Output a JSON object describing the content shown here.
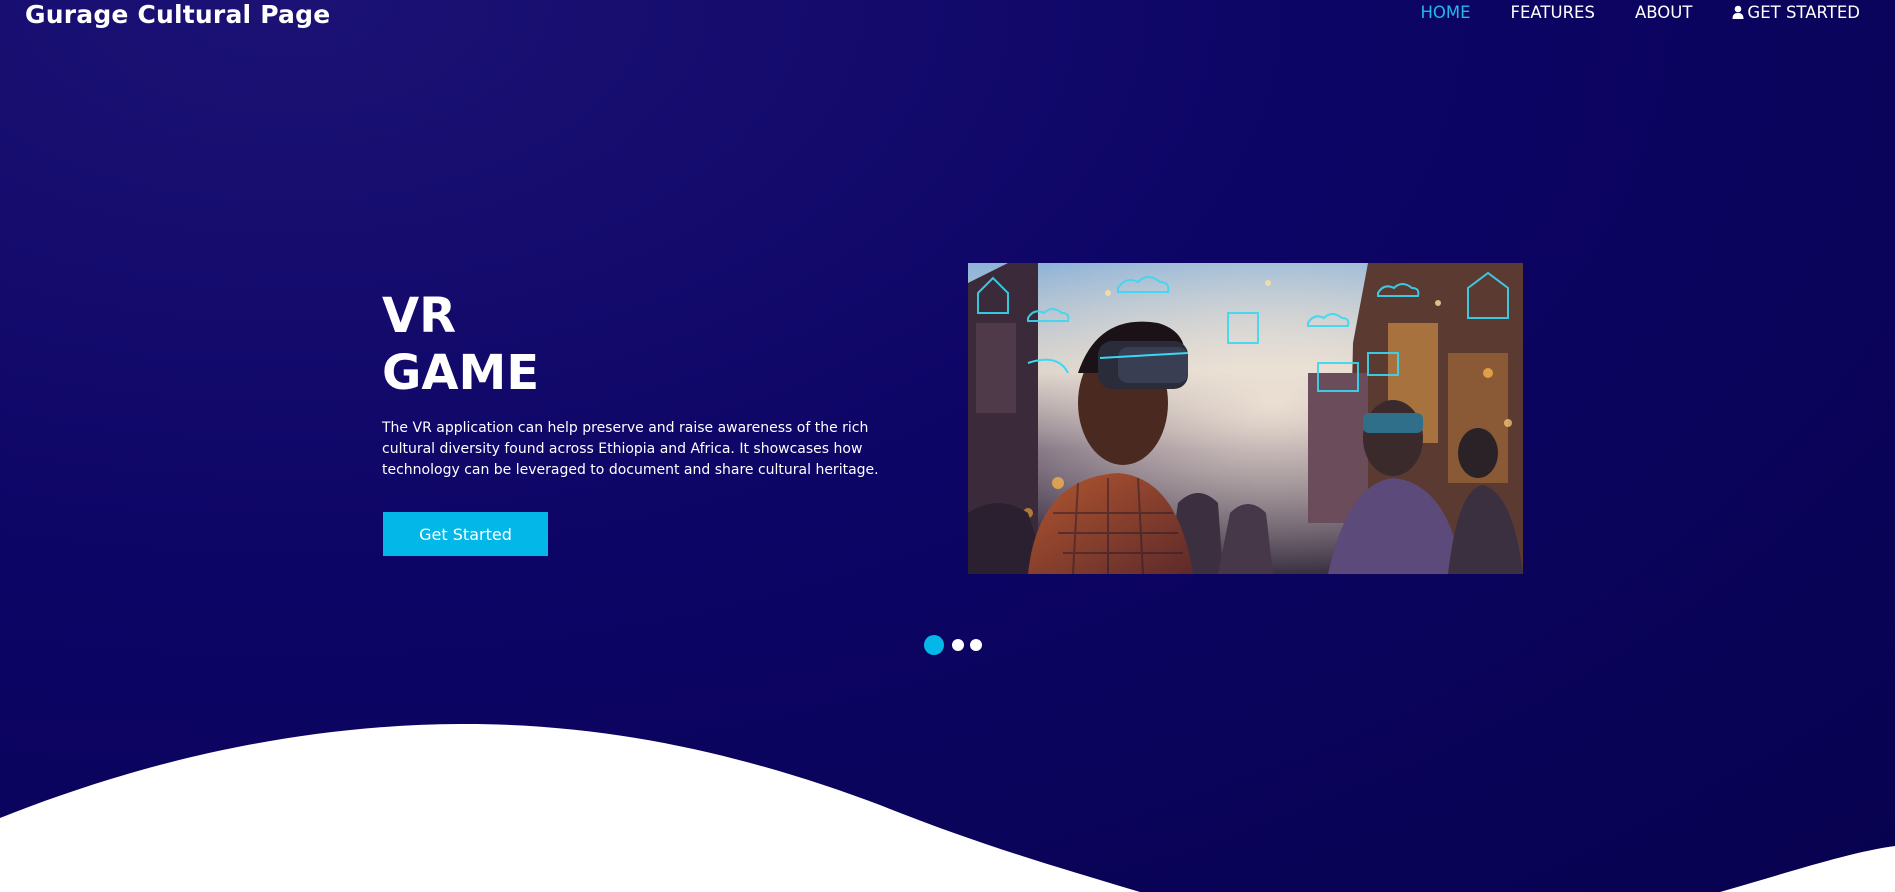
{
  "header": {
    "brand": "Gurage Cultural Page"
  },
  "nav": {
    "items": [
      {
        "label": "HOME",
        "active": true
      },
      {
        "label": "FEATURES",
        "active": false
      },
      {
        "label": "ABOUT",
        "active": false
      },
      {
        "label": "GET STARTED",
        "active": false,
        "icon": "user-icon"
      }
    ]
  },
  "hero": {
    "title_line1": "VR",
    "title_line2": "GAME",
    "description": "The VR application can help preserve and raise awareness of the rich cultural diversity found across Ethiopia and Africa. It showcases how technology can be leveraged to document and share cultural heritage.",
    "cta_label": "Get Started",
    "image_icon": "vr-street-scene-image"
  },
  "carousel": {
    "slide_count": 3,
    "active_index": 0
  },
  "colors": {
    "background": "#0d0566",
    "accent": "#03b8e8",
    "nav_active": "#22b8ee",
    "text": "#ffffff"
  }
}
